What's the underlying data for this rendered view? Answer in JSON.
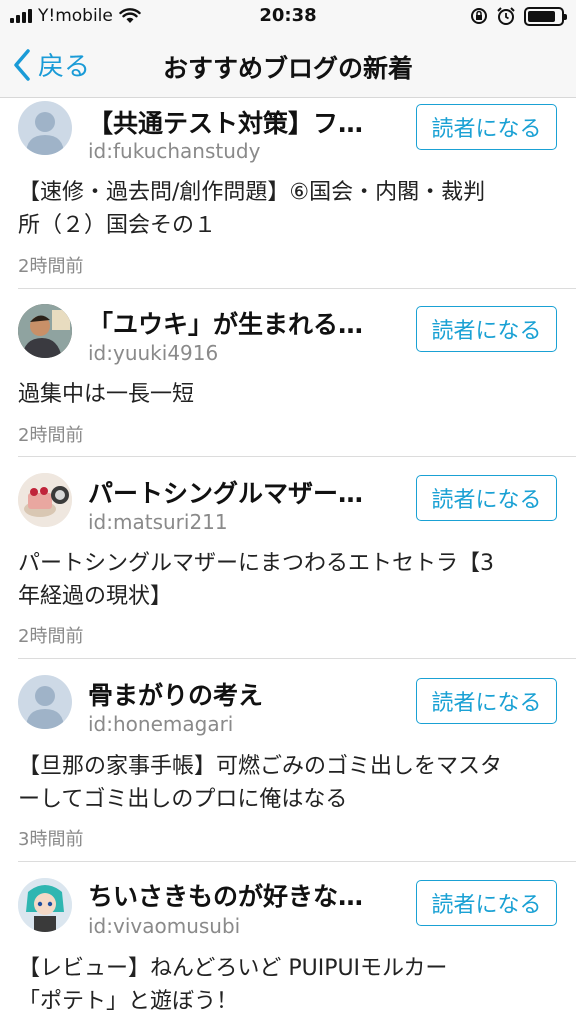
{
  "status_bar": {
    "carrier": "Y!mobile",
    "time": "20:38",
    "battery_level": 0.85,
    "icons": [
      "signal-icon",
      "wifi-icon",
      "rotation-lock-icon",
      "alarm-icon",
      "battery-icon"
    ]
  },
  "nav": {
    "back_label": "戻る",
    "title": "おすすめブログの新着"
  },
  "subscribe_label": "読者になる",
  "colors": {
    "accent": "#1aa1d4",
    "muted": "#8a8a8a"
  },
  "items": [
    {
      "blog_title": "【共通テスト対策】フ…",
      "blog_id": "id:fukuchanstudy",
      "entry_lines": [
        "【速修・過去問/創作問題】⑥国会・内閣・裁判",
        "所（２）国会その１"
      ],
      "time": "2時間前",
      "avatar": "default-avatar-icon"
    },
    {
      "blog_title": "「ユウキ」が生まれる…",
      "blog_id": "id:yuuki4916",
      "entry_lines": [
        "過集中は一長一短"
      ],
      "time": "2時間前",
      "avatar": "photo-avatar"
    },
    {
      "blog_title": "パートシングルマザー…",
      "blog_id": "id:matsuri211",
      "entry_lines": [
        "パートシングルマザーにまつわるエトセトラ【3",
        "年経過の現状】"
      ],
      "time": "2時間前",
      "avatar": "cake-avatar"
    },
    {
      "blog_title": "骨まがりの考え",
      "blog_id": "id:honemagari",
      "entry_lines": [
        "【旦那の家事手帳】可燃ごみのゴミ出しをマスタ",
        "ーしてゴミ出しのプロに俺はなる"
      ],
      "time": "3時間前",
      "avatar": "default-avatar-icon"
    },
    {
      "blog_title": "ちいさきものが好きな…",
      "blog_id": "id:vivaomusubi",
      "entry_lines": [
        "【レビュー】ねんどろいど PUIPUIモルカー",
        "「ポテト」と遊ぼう！"
      ],
      "time": "",
      "avatar": "figure-avatar"
    }
  ]
}
